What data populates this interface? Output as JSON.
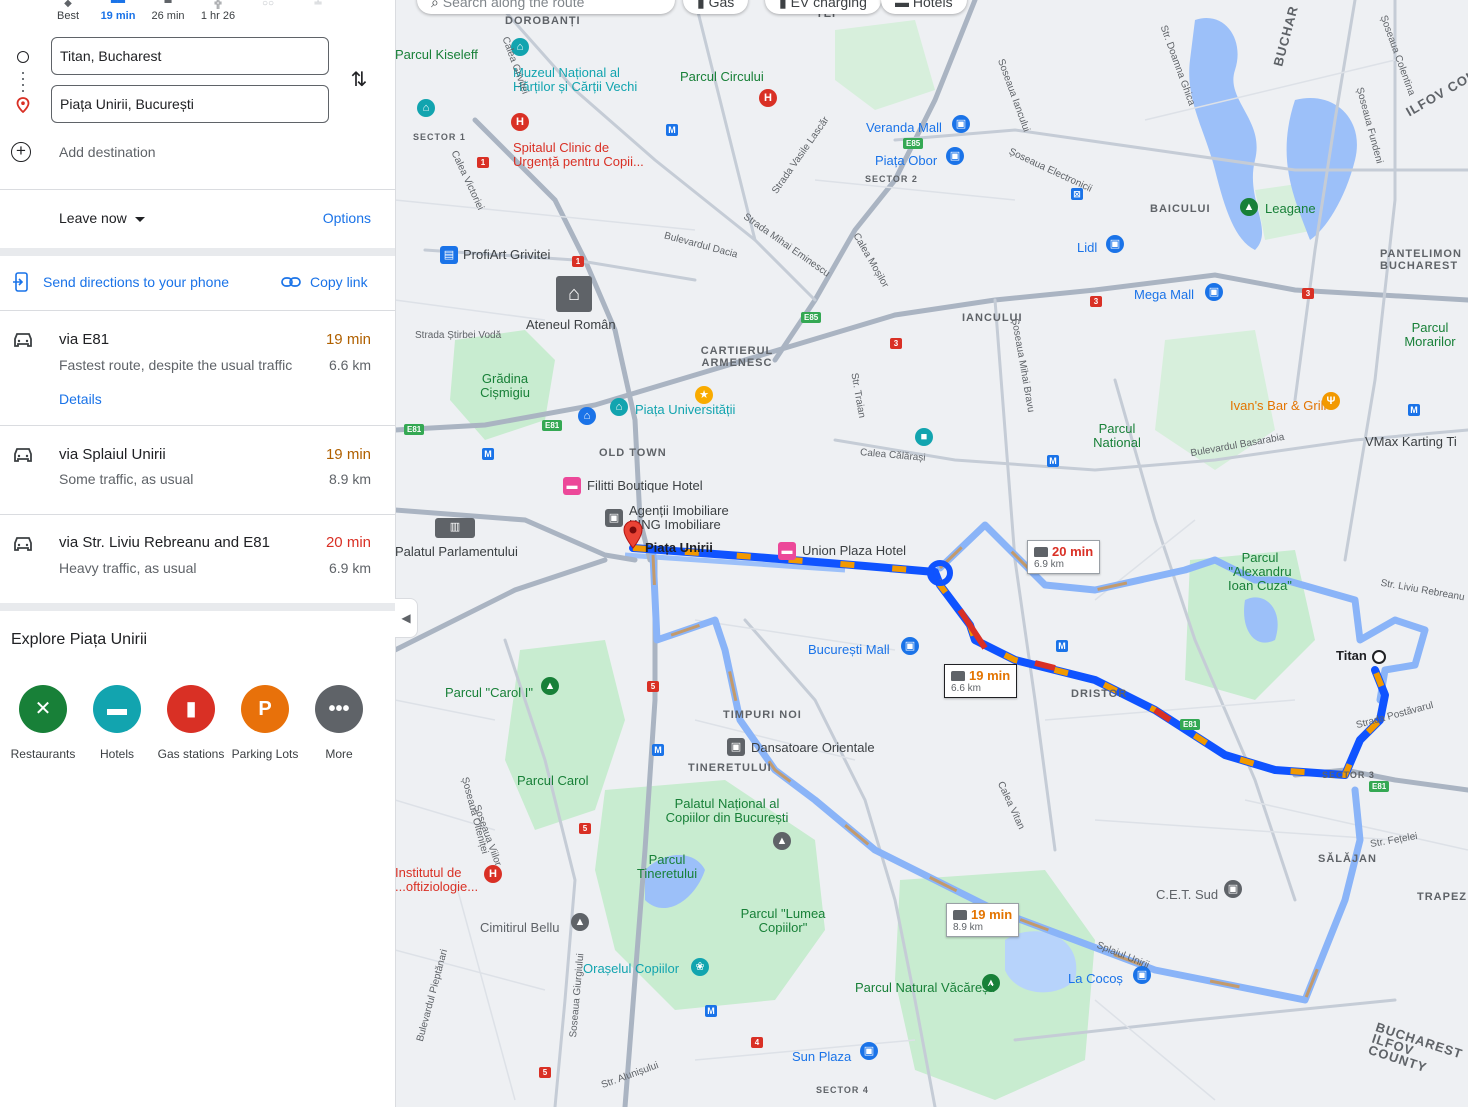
{
  "travel_modes": [
    {
      "label": "Best",
      "active": false
    },
    {
      "label": "19 min",
      "active": true
    },
    {
      "label": "26 min",
      "active": false
    },
    {
      "label": "1 hr 26",
      "active": false
    },
    {
      "label": "",
      "active": false
    },
    {
      "label": "",
      "active": false
    }
  ],
  "waypoints": {
    "origin": "Titan, Bucharest",
    "destination": "Piața Unirii, București",
    "add_destination": "Add destination"
  },
  "leave_now": "Leave now",
  "options": "Options",
  "send_to_phone": "Send directions to your phone",
  "copy_link": "Copy link",
  "routes": [
    {
      "name": "via E81",
      "desc": "Fastest route, despite the usual traffic",
      "time": "19 min",
      "dist": "6.6 km",
      "details": "Details",
      "time_color": "#b06000"
    },
    {
      "name": "via Splaiul Unirii",
      "desc": "Some traffic, as usual",
      "time": "19 min",
      "dist": "8.9 km",
      "time_color": "#b06000"
    },
    {
      "name": "via Str. Liviu Rebreanu and E81",
      "desc": "Heavy traffic, as usual",
      "time": "20 min",
      "dist": "6.9 km",
      "time_color": "#d93025"
    }
  ],
  "explore": {
    "title": "Explore Piața Unirii",
    "categories": [
      {
        "label": "Restaurants",
        "icon": "fork-knife-icon",
        "color": "#188038"
      },
      {
        "label": "Hotels",
        "icon": "bed-icon",
        "color": "#12a4af"
      },
      {
        "label": "Gas stations",
        "icon": "fuel-icon",
        "color": "#d93025"
      },
      {
        "label": "Parking Lots",
        "icon": "parking-icon",
        "color": "#e8710a"
      },
      {
        "label": "More",
        "icon": "more-dots-icon",
        "color": "#5f6368"
      }
    ]
  },
  "map": {
    "search_placeholder": "Search along the route",
    "chips": [
      "Gas",
      "EV charging",
      "Hotels"
    ],
    "route_callouts": [
      {
        "time": "20 min",
        "dist": "6.9 km",
        "color": "#d93025"
      },
      {
        "time": "19 min",
        "dist": "6.6 km",
        "color": "#e37400"
      },
      {
        "time": "19 min",
        "dist": "8.9 km",
        "color": "#e37400"
      }
    ],
    "places": [
      "Muzeul Național al Hărților și Cărții Vechi",
      "Parcul Circului",
      "Veranda Mall",
      "Piața Obor",
      "Spitalul Clinic de Urgență pentru Copii...",
      "ProfiArt Grivitei",
      "Ateneul Român",
      "Piața Universității",
      "Grădina Cișmigiu",
      "Filitti Boutique Hotel",
      "Agenții Imobiliare KING Imobiliare",
      "Piața Unirii",
      "Union Plaza Hotel",
      "Palatul Parlamentului",
      "București Mall",
      "Parcul \"Carol I\"",
      "Dansatoare Orientale",
      "Parcul Carol",
      "Palatul Național al Copiilor din București",
      "Parcul Tineretului",
      "Parcul \"Lumea Copiilor\"",
      "Cimitirul Bellu",
      "Orașelul Copiilor",
      "Parcul Natural Văcărești",
      "Sun Plaza",
      "Leagane",
      "Lidl",
      "Mega Mall",
      "Parcul Morarilor",
      "Ivan's Bar & Grill",
      "VMax Karting Ti",
      "Parcul National",
      "Parcul \"Alexandru Ioan Cuza\"",
      "Titan",
      "C.E.T. Sud",
      "La Cocoș",
      "Institutul de ...oftiziologie...",
      "Parcul Kiseleff"
    ],
    "areas": [
      "DOROBANȚI",
      "SECTOR 1",
      "SECTOR 2",
      "BAICULUI",
      "PANTELIMON BUCHAREST",
      "IANCULUI",
      "CARTIERUL ARMENESC",
      "OLD TOWN",
      "DRISTOR",
      "TIMPURI NOI",
      "TINERETULUI",
      "SECTOR 3",
      "SĂLĂJAN",
      "TRAPEZ",
      "SECTOR 4",
      "BUCHAREST ILFOV COUNTY",
      "ILFOV COUNTY",
      "BUCHAR",
      "TEI"
    ],
    "streets": [
      "Calea Victoriei",
      "Strada Mihai Eminescu",
      "Bulevardul Dacia",
      "Strada Știrbei Vodă",
      "Calea Călărași",
      "Bulevardul Basarabia",
      "Splaiul Unirii",
      "Calea Vitan",
      "Strada Postăvarul",
      "Str. Liviu Rebreanu",
      "Str. Fețelei",
      "Bulevardul Pieptănari",
      "Șoseaua Olteniței",
      "Soseaua Giurgiului",
      "Str. Alunișului",
      "Calea Moșilor",
      "Str. Traian",
      "Șoseaua Mihai Bravu",
      "Soseaua Iancului",
      "Șoseaua Fundeni",
      "Șoseaua Colentina",
      "Str. Doamna Ghica",
      "Strada Vasile Lascăr",
      "Șoseaua Electronicii",
      "Calea Griviței",
      "Șoseaua Viilor"
    ]
  }
}
